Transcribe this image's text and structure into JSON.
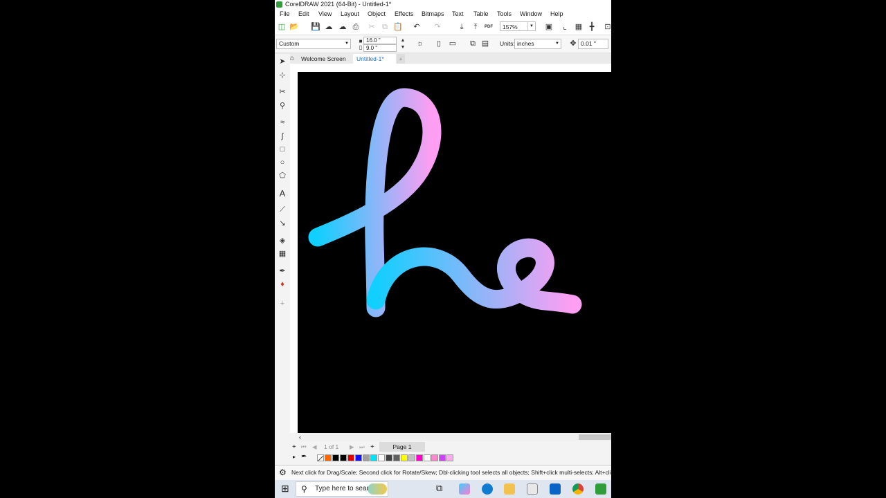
{
  "window": {
    "title": "CorelDRAW 2021 (64-Bit) - Untitled-1*"
  },
  "menu": [
    "File",
    "Edit",
    "View",
    "Layout",
    "Object",
    "Effects",
    "Bitmaps",
    "Text",
    "Table",
    "Tools",
    "Window",
    "Help"
  ],
  "toolbar": {
    "zoom": "157%",
    "pdf_label": "PDF"
  },
  "property_bar": {
    "page_size": "Custom",
    "width": "16.0 \"",
    "height": "9.0 \"",
    "units_label": "Units:",
    "units_value": "inches",
    "nudge": "0.01 \""
  },
  "tabs": {
    "welcome": "Welcome Screen",
    "document": "Untitled-1*",
    "add": "+"
  },
  "page_nav": {
    "counter": "1 of 1",
    "page_tab": "Page 1"
  },
  "palette": [
    "#ff6a00",
    "#000000",
    "#000000",
    "#e00000",
    "#1010ff",
    "#a0a0a0",
    "#00e5ff",
    "#ffffff",
    "#404040",
    "#606060",
    "#ffff00",
    "#c0c0c0",
    "#ff00cc",
    "#ffffff",
    "#ff88cc",
    "#cc44ff",
    "#ffaaee"
  ],
  "status": {
    "hint": "Next click for Drag/Scale; Second click for Rotate/Skew; Dbl-clicking tool selects all objects; Shift+click multi-selects; Alt+click digs"
  },
  "taskbar": {
    "search_placeholder": "Type here to search"
  },
  "artwork": {
    "gradient_start": "#11cfff",
    "gradient_end": "#ff9ef2"
  }
}
